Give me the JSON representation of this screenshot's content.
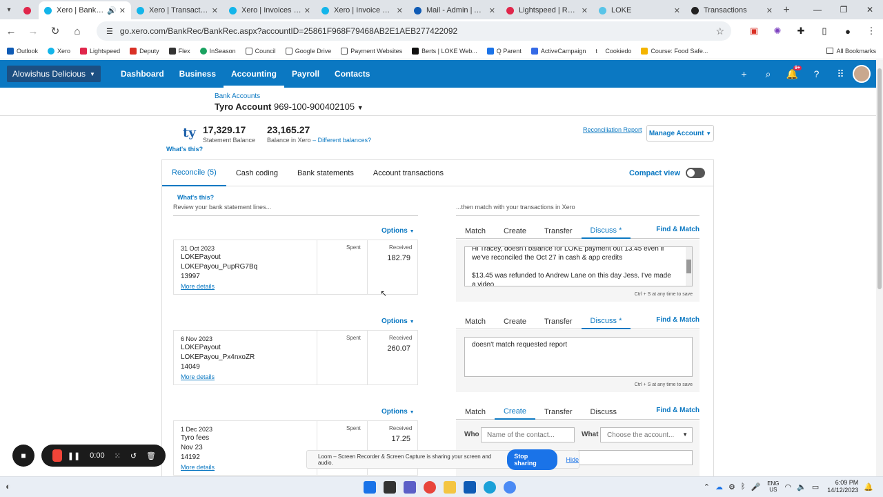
{
  "browser": {
    "tabs": [
      {
        "title": "",
        "color": "#e0264b"
      },
      {
        "title": "Xero | Bank Reco",
        "color": "#13b5ea",
        "active": true
      },
      {
        "title": "Xero | Transactions fo",
        "color": "#13b5ea"
      },
      {
        "title": "Xero | Invoices | Alow",
        "color": "#13b5ea"
      },
      {
        "title": "Xero | Invoice KTA-58",
        "color": "#13b5ea"
      },
      {
        "title": "Mail - Admin | Alowi",
        "color": "#0f5bb5"
      },
      {
        "title": "Lightspeed | Report",
        "color": "#e0264b"
      },
      {
        "title": "LOKE",
        "color": "#58c4e8"
      },
      {
        "title": "Transactions",
        "color": "#222222"
      }
    ],
    "url": "go.xero.com/BankRec/BankRec.aspx?accountID=25861F968F79468AB2E1AEB277422092",
    "bookmarks": [
      "Outlook",
      "Xero",
      "Lightspeed",
      "Deputy",
      "Flex",
      "InSeason",
      "Council",
      "Google Drive",
      "Payment Websites",
      "Berts | LOKE Web...",
      "Q Parent",
      "ActiveCampaign",
      "Cookiedo",
      "Course: Food Safe..."
    ],
    "all_bookmarks": "All Bookmarks"
  },
  "xero": {
    "org": "Alowishus Delicious",
    "nav": [
      "Dashboard",
      "Business",
      "Accounting",
      "Payroll",
      "Contacts"
    ],
    "notif_badge": "9+"
  },
  "account": {
    "breadcrumb": "Bank Accounts",
    "name": "Tyro Account",
    "number": "969-100-900402105",
    "logo": "ty",
    "statement_balance": "17,329.17",
    "statement_label": "Statement Balance",
    "xero_balance": "23,165.27",
    "xero_label": "Balance in Xero",
    "diff_link": "– Different balances?",
    "whats_this": "What's this?",
    "recon_report": "Reconciliation Report",
    "manage": "Manage Account"
  },
  "panel": {
    "tabs": [
      "Reconcile (5)",
      "Cash coding",
      "Bank statements",
      "Account transactions"
    ],
    "compact": "Compact view",
    "whats_this": "What's this?",
    "review": "Review your bank statement lines...",
    "then_match": "...then match with your transactions in Xero",
    "options": "Options",
    "spent": "Spent",
    "received": "Received",
    "more": "More details",
    "match_tabs": [
      "Match",
      "Create",
      "Transfer"
    ],
    "find_match": "Find & Match",
    "ctrl_s": "Ctrl + S at any time to save",
    "who": "Who",
    "who_placeholder": "Name of the contact...",
    "what": "What",
    "what_placeholder": "Choose the account..."
  },
  "lines": [
    {
      "date": "31 Oct 2023",
      "l1": "LOKEPayout",
      "l2": "LOKEPayou_PupRG7Bq",
      "l3": "13997",
      "amount": "182.79",
      "discuss_tab": "Discuss *",
      "note_top": "Hi Tracey, doesn't balance for LOKE payment out 13.45 even if",
      "note_2": "we've reconciled the Oct 27 in cash & app credits",
      "note_3": "$13.45 was refunded to Andrew Lane on this day Jess.  I've made",
      "note_4": "a video"
    },
    {
      "date": "6 Nov 2023",
      "l1": "LOKEPayout",
      "l2": "LOKEPayou_Px4nxoZR",
      "l3": "14049",
      "amount": "260.07",
      "discuss_tab": "Discuss *",
      "note_top": "doesn't match requested report"
    },
    {
      "date": "1 Dec 2023",
      "l1": "Tyro fees",
      "l2": "Nov 23",
      "l3": "14192",
      "amount": "17.25",
      "discuss_tab": "Discuss"
    }
  ],
  "loom": {
    "timer": "0:00",
    "bar_text": "Loom – Screen Recorder & Screen Capture is sharing your screen and audio.",
    "stop": "Stop sharing",
    "hide": "Hide"
  },
  "taskbar": {
    "lang1": "ENG",
    "lang2": "US",
    "time": "6:09 PM",
    "date": "14/12/2023"
  }
}
